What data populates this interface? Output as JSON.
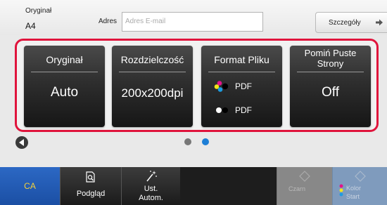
{
  "header": {
    "original_label": "Oryginał",
    "original_size": "A4",
    "address_label": "Adres",
    "address_placeholder": "Adres E-mail",
    "details_label": "Szczegóły"
  },
  "settings": [
    {
      "title": "Oryginał",
      "value": "Auto"
    },
    {
      "title": "Rozdzielczość",
      "value": "200x200dpi"
    },
    {
      "title": "Format Pliku",
      "color_format": "PDF",
      "bw_format": "PDF"
    },
    {
      "title_line1": "Pomiń Puste",
      "title_line2": "Strony",
      "value": "Off"
    }
  ],
  "pager": {
    "pages": 2,
    "current_page": 2,
    "active_color": "#1e7fd6",
    "inactive_color": "#777777"
  },
  "bottom": {
    "ca_label": "CA",
    "preview_label": "Podgląd",
    "auto_setup_line1": "Ust.",
    "auto_setup_line2": "Autom.",
    "copy_label": "Czarn",
    "start_line1": "Kolor",
    "start_line2": "Start"
  },
  "colors": {
    "accent_frame": "#e0143c",
    "ca_text": "#f4d23a",
    "ca_background": "#2c68c4"
  },
  "icons": [
    "arrow-right-icon",
    "back-arrow-icon",
    "preview-icon",
    "magic-wand-icon",
    "diamond-icon",
    "color-dots-icon",
    "bw-dots-icon"
  ]
}
